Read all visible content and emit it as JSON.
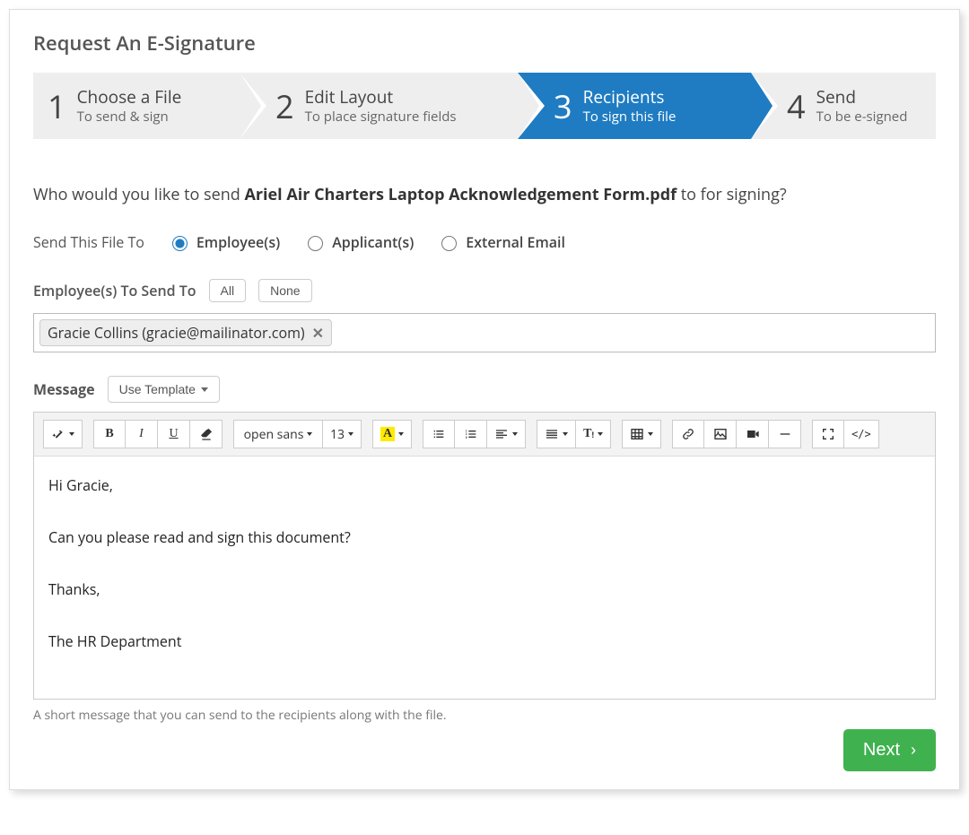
{
  "title": "Request An E-Signature",
  "steps": [
    {
      "num": "1",
      "title": "Choose a File",
      "sub": "To send & sign"
    },
    {
      "num": "2",
      "title": "Edit Layout",
      "sub": "To place signature fields"
    },
    {
      "num": "3",
      "title": "Recipients",
      "sub": "To sign this file"
    },
    {
      "num": "4",
      "title": "Send",
      "sub": "To be e-signed"
    }
  ],
  "prompt": {
    "prefix": "Who would you like to send ",
    "filename": "Ariel Air Charters Laptop Acknowledgement Form.pdf",
    "suffix": " to for signing?"
  },
  "sendTo": {
    "label": "Send This File To",
    "options": {
      "employees": "Employee(s)",
      "applicants": "Applicant(s)",
      "external": "External Email"
    }
  },
  "employees": {
    "label": "Employee(s) To Send To",
    "all": "All",
    "none": "None",
    "token": "Gracie Collins (gracie@mailinator.com)"
  },
  "message": {
    "label": "Message",
    "useTemplate": "Use Template",
    "font": "open sans",
    "size": "13",
    "body": {
      "l1": "Hi Gracie,",
      "l2": "Can you please read and sign this document?",
      "l3": "Thanks,",
      "l4": "The HR Department"
    },
    "helper": "A short message that you can send to the recipients along with the file."
  },
  "next": "Next"
}
